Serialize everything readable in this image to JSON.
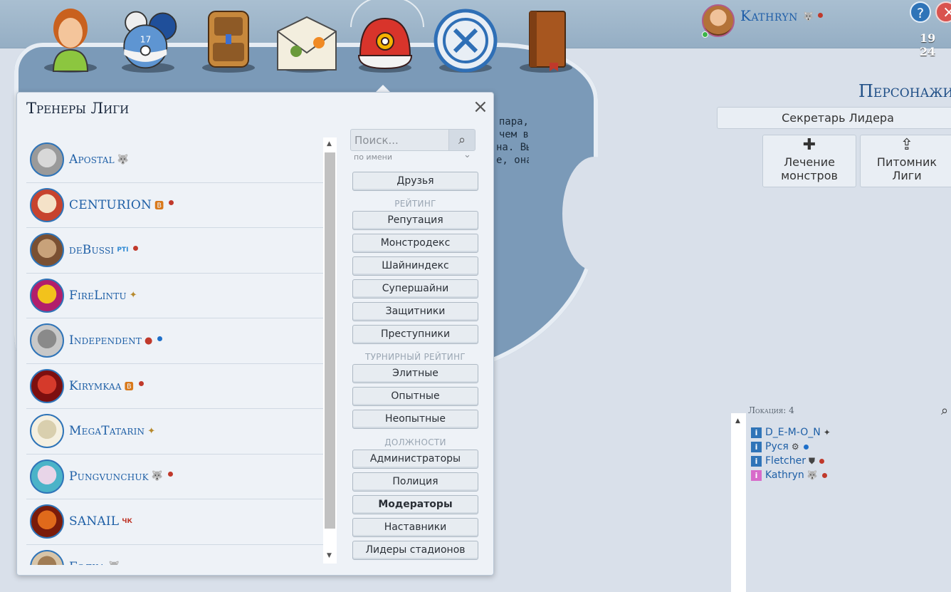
{
  "header": {
    "user_name": "Kathryn",
    "clock": "19 24",
    "help_label": "?",
    "close_label": "×"
  },
  "nav_icons": [
    "trainer-icon",
    "pokeballs-icon",
    "backpack-icon",
    "mail-icon",
    "cap-icon",
    "league-badge-icon",
    "book-icon"
  ],
  "background_text": [
    "пара,",
    "чем в",
    "на. Вы",
    "е, она"
  ],
  "modal": {
    "title": "Тренеры Лиги",
    "close": "×",
    "search_placeholder": "Поиск...",
    "search_mode": "по имени",
    "friends_button": "Друзья",
    "rating_label": "РЕЙТИНГ",
    "tournament_label": "ТУРНИРНЫЙ РЕЙТИНГ",
    "positions_label": "ДОЛЖНОСТИ",
    "rating_buttons": [
      "Репутация",
      "Монстродекс",
      "Шайниндекс",
      "Супершайни",
      "Защитники",
      "Преступники"
    ],
    "tournament_buttons": [
      "Элитные",
      "Опытные",
      "Неопытные"
    ],
    "position_buttons": [
      "Администраторы",
      "Полиция",
      "Модераторы",
      "Наставники",
      "Лидеры стадионов"
    ]
  },
  "trainers": [
    {
      "name": "Apostal",
      "badge": "wolf-icon",
      "online": null,
      "avatar": [
        "#9a9a9a",
        "#d8d8d8"
      ]
    },
    {
      "name": "CENTURION",
      "badge": "B-badge-icon",
      "online": "#c0392b",
      "avatar": [
        "#c7432e",
        "#f4e2c8"
      ]
    },
    {
      "name": "deBussi",
      "badge": "PTI",
      "online": "#c0392b",
      "avatar": [
        "#7a5032",
        "#c8a27a"
      ]
    },
    {
      "name": "FireLintu",
      "badge": "feather-icon",
      "online": null,
      "avatar": [
        "#b21e6b",
        "#f2c21c"
      ]
    },
    {
      "name": "Independent",
      "badge": "flame-icon",
      "online": "#1e6fc9",
      "avatar": [
        "#c8c8c8",
        "#8a8a8a"
      ]
    },
    {
      "name": "Kirymkaa",
      "badge": "B-badge-icon",
      "online": "#c0392b",
      "avatar": [
        "#7d0f0f",
        "#d53a2b"
      ]
    },
    {
      "name": "MegaTatarin",
      "badge": "feather-icon",
      "online": null,
      "avatar": [
        "#f5f0e1",
        "#d9cfae"
      ]
    },
    {
      "name": "Pungvunchuk",
      "badge": "wolf-icon",
      "online": "#c0392b",
      "avatar": [
        "#4bb3c8",
        "#e8d5e8"
      ]
    },
    {
      "name": "SANAIL",
      "badge": "ЧК",
      "online": null,
      "avatar": [
        "#7a1b0a",
        "#e06a1b"
      ]
    },
    {
      "name": "Бэлка",
      "badge": "wolf-icon",
      "online": null,
      "avatar": [
        "#d8c5a8",
        "#a07c54"
      ]
    }
  ],
  "right_panel": {
    "title": "Персонажи",
    "secretary": "Секретарь Лидера",
    "heal_label": "Лечение монстров",
    "heal_icon": "plus-icon",
    "nursery_label": "Питомник Лиги",
    "nursery_icon": "upload-icon"
  },
  "location": {
    "label": "Локация: 4",
    "players": [
      {
        "name": "D_E-M-O_N",
        "badge": "feather-icon",
        "dot": null,
        "pink": false
      },
      {
        "name": "Руся",
        "badge": "gear-icon",
        "dot": "#1e6fc9",
        "pink": false
      },
      {
        "name": "Fletcher",
        "badge": "shield-icon",
        "dot": "#c0392b",
        "pink": false
      },
      {
        "name": "Kathryn",
        "badge": "wolf-icon",
        "dot": "#c0392b",
        "pink": true
      }
    ]
  }
}
